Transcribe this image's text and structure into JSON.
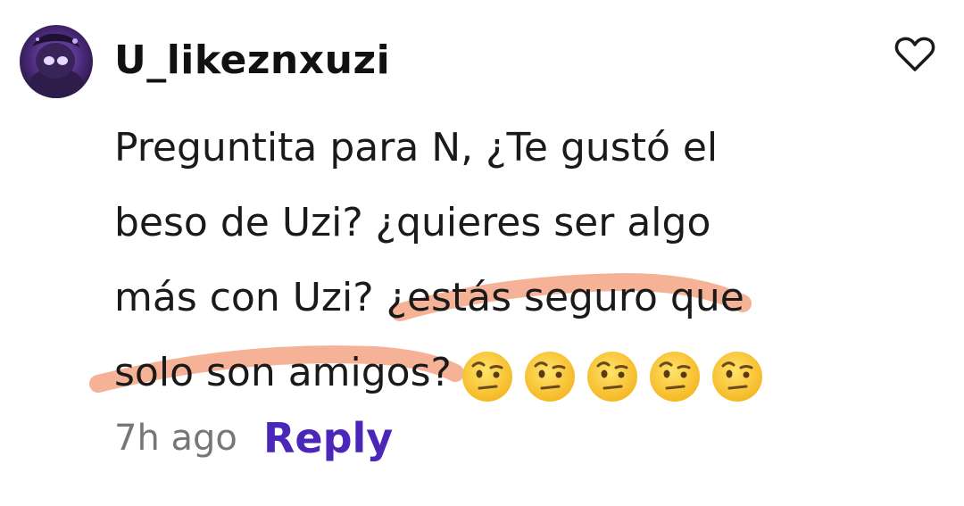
{
  "comment": {
    "username": "U_likeznxuzi",
    "lines": [
      "Preguntita para N, ¿Te gustó el",
      "beso de Uzi? ¿quieres ser algo",
      "más con Uzi? ¿estás seguro que",
      "solo son amigos?"
    ],
    "emoji_count": 5,
    "emoji_icon": "face-with-raised-eyebrow-icon",
    "timestamp": "7h ago",
    "reply_label": "Reply"
  },
  "colors": {
    "highlight": "#f4a584",
    "reply": "#4a27b8",
    "timestamp": "#777777",
    "avatar_bg": "#5b3a8c"
  }
}
